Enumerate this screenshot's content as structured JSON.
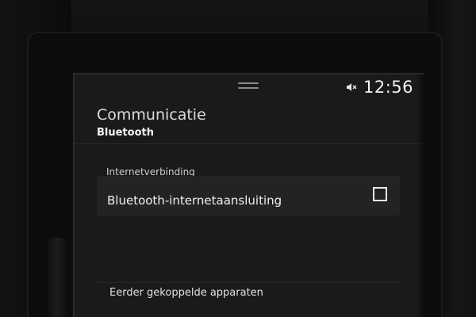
{
  "status_bar": {
    "time": "12:56",
    "icons": [
      "drag-handle-icon",
      "volume-mute-icon"
    ]
  },
  "header": {
    "title": "Communicatie",
    "subtitle": "Bluetooth"
  },
  "sections": {
    "internet": {
      "header": "Internetverbinding",
      "items": [
        {
          "label": "Bluetooth-internetaansluiting",
          "checked": false
        }
      ]
    },
    "paired": {
      "header": "Eerder gekoppelde apparaten"
    }
  },
  "colors": {
    "screen_bg": "#1a1a1b",
    "row_bg": "#232324",
    "text_primary": "#f0f0f0",
    "title_color": "#d8dde4"
  }
}
